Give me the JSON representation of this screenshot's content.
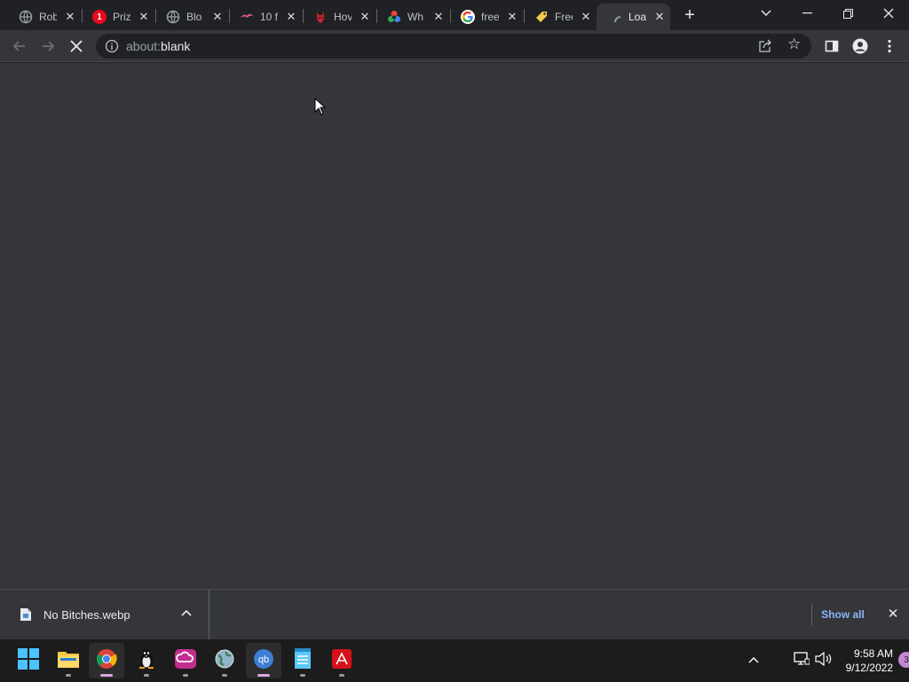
{
  "tabs": [
    {
      "title": "Rob",
      "icon": "globe-icon",
      "color": "#9aa0a6"
    },
    {
      "title": "Priz",
      "icon": "prizes-badge-icon",
      "color": "#e8091c",
      "badge": "1"
    },
    {
      "title": "Blo",
      "icon": "globe-icon",
      "color": "#9aa0a6"
    },
    {
      "title": "10 f",
      "icon": "bird-icon",
      "color": "#e85a8a"
    },
    {
      "title": "Hov",
      "icon": "devil-icon",
      "color": "#d11f2e"
    },
    {
      "title": "Wh",
      "icon": "colorwheel-icon",
      "color": "#7a5cff"
    },
    {
      "title": "free",
      "icon": "google-icon",
      "color": "#4285f4"
    },
    {
      "title": "Free",
      "icon": "tag-icon",
      "color": "#f2c94c"
    },
    {
      "title": "Loa",
      "icon": "loading-spinner-icon",
      "color": "#9aa0a6",
      "active": true
    }
  ],
  "toolbar": {
    "url_scheme": "about:",
    "url_path": "blank"
  },
  "download": {
    "filename": "No Bitches.webp",
    "show_all": "Show all"
  },
  "taskbar": {
    "apps": [
      {
        "name": "start-button",
        "icon": "windows-logo-icon"
      },
      {
        "name": "taskbar-file-explorer",
        "icon": "folder-icon"
      },
      {
        "name": "taskbar-chrome",
        "icon": "chrome-icon",
        "active": true
      },
      {
        "name": "taskbar-penguin-app",
        "icon": "penguin-icon"
      },
      {
        "name": "taskbar-creative-cloud",
        "icon": "creative-cloud-icon"
      },
      {
        "name": "taskbar-globe-app",
        "icon": "globe-app-icon"
      },
      {
        "name": "taskbar-qbittorrent",
        "icon": "qbittorrent-icon",
        "active": true
      },
      {
        "name": "taskbar-notepad",
        "icon": "notepad-icon"
      },
      {
        "name": "taskbar-adobe",
        "icon": "adobe-icon"
      }
    ],
    "time": "9:58 AM",
    "date": "9/12/2022",
    "notification_count": "3"
  },
  "colors": {
    "accent": "#8ab4f8",
    "content_bg": "#35363a",
    "tabstrip_bg": "#202124",
    "taskbar_bg": "#1c1c1c"
  }
}
